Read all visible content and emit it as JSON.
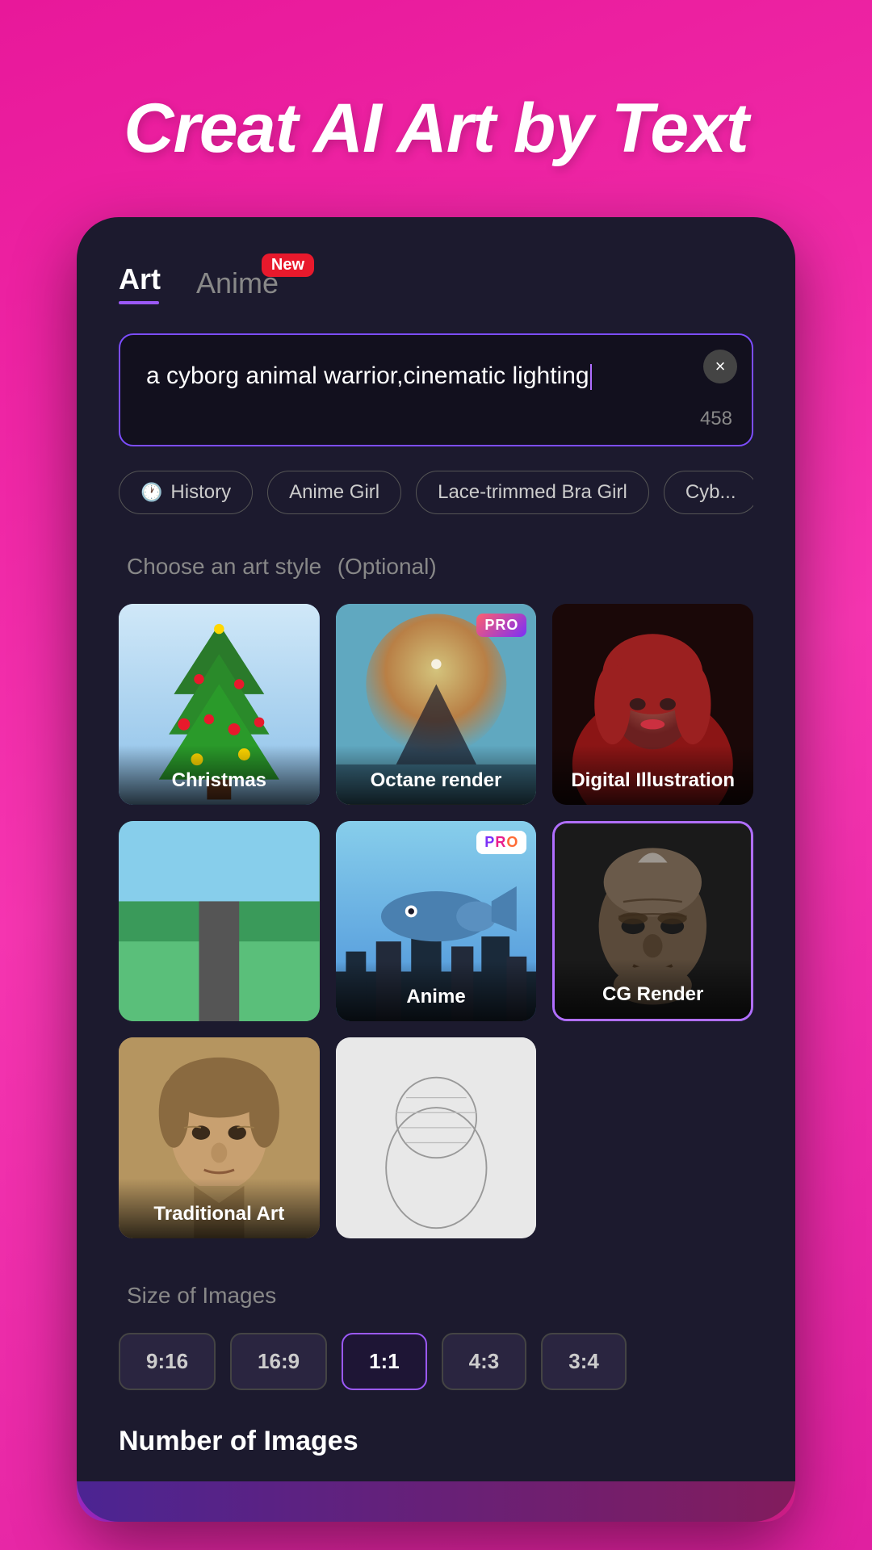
{
  "hero": {
    "title": "Creat AI Art by Text"
  },
  "tabs": [
    {
      "id": "art",
      "label": "Art",
      "active": true,
      "badge": null
    },
    {
      "id": "anime",
      "label": "Anime",
      "active": false,
      "badge": "New"
    }
  ],
  "input": {
    "text": "a cyborg animal warrior,cinematic lighting",
    "charCount": "458",
    "clearIcon": "×"
  },
  "chips": [
    {
      "id": "history",
      "label": "History",
      "icon": "🕐"
    },
    {
      "id": "anime-girl",
      "label": "Anime Girl",
      "icon": null
    },
    {
      "id": "lace-bra-girl",
      "label": "Lace-trimmed Bra Girl",
      "icon": null
    },
    {
      "id": "cyb",
      "label": "Cyb...",
      "icon": null
    }
  ],
  "artStyleSection": {
    "title": "Choose an art style",
    "optional": "(Optional)",
    "styles": [
      {
        "id": "christmas",
        "label": "Christmas",
        "pro": false,
        "selected": false
      },
      {
        "id": "octane",
        "label": "Octane render",
        "pro": true,
        "selected": false
      },
      {
        "id": "digital",
        "label": "Digital Illustration",
        "pro": false,
        "selected": false
      },
      {
        "id": "extra1",
        "label": "",
        "pro": false,
        "selected": false
      },
      {
        "id": "anime",
        "label": "Anime",
        "pro": true,
        "selected": false
      },
      {
        "id": "cg",
        "label": "CG Render",
        "pro": false,
        "selected": true
      },
      {
        "id": "traditional",
        "label": "Traditional Art",
        "pro": false,
        "selected": false
      },
      {
        "id": "extra2",
        "label": "",
        "pro": false,
        "selected": false
      }
    ]
  },
  "sizeSection": {
    "title": "Size of Images",
    "options": [
      {
        "id": "9-16",
        "label": "9:16",
        "active": false
      },
      {
        "id": "16-9",
        "label": "16:9",
        "active": false
      },
      {
        "id": "1-1",
        "label": "1:1",
        "active": true
      },
      {
        "id": "4-3",
        "label": "4:3",
        "active": false
      },
      {
        "id": "3-4",
        "label": "3:4",
        "active": false
      }
    ]
  },
  "numImagesSection": {
    "title": "Number of Images"
  }
}
